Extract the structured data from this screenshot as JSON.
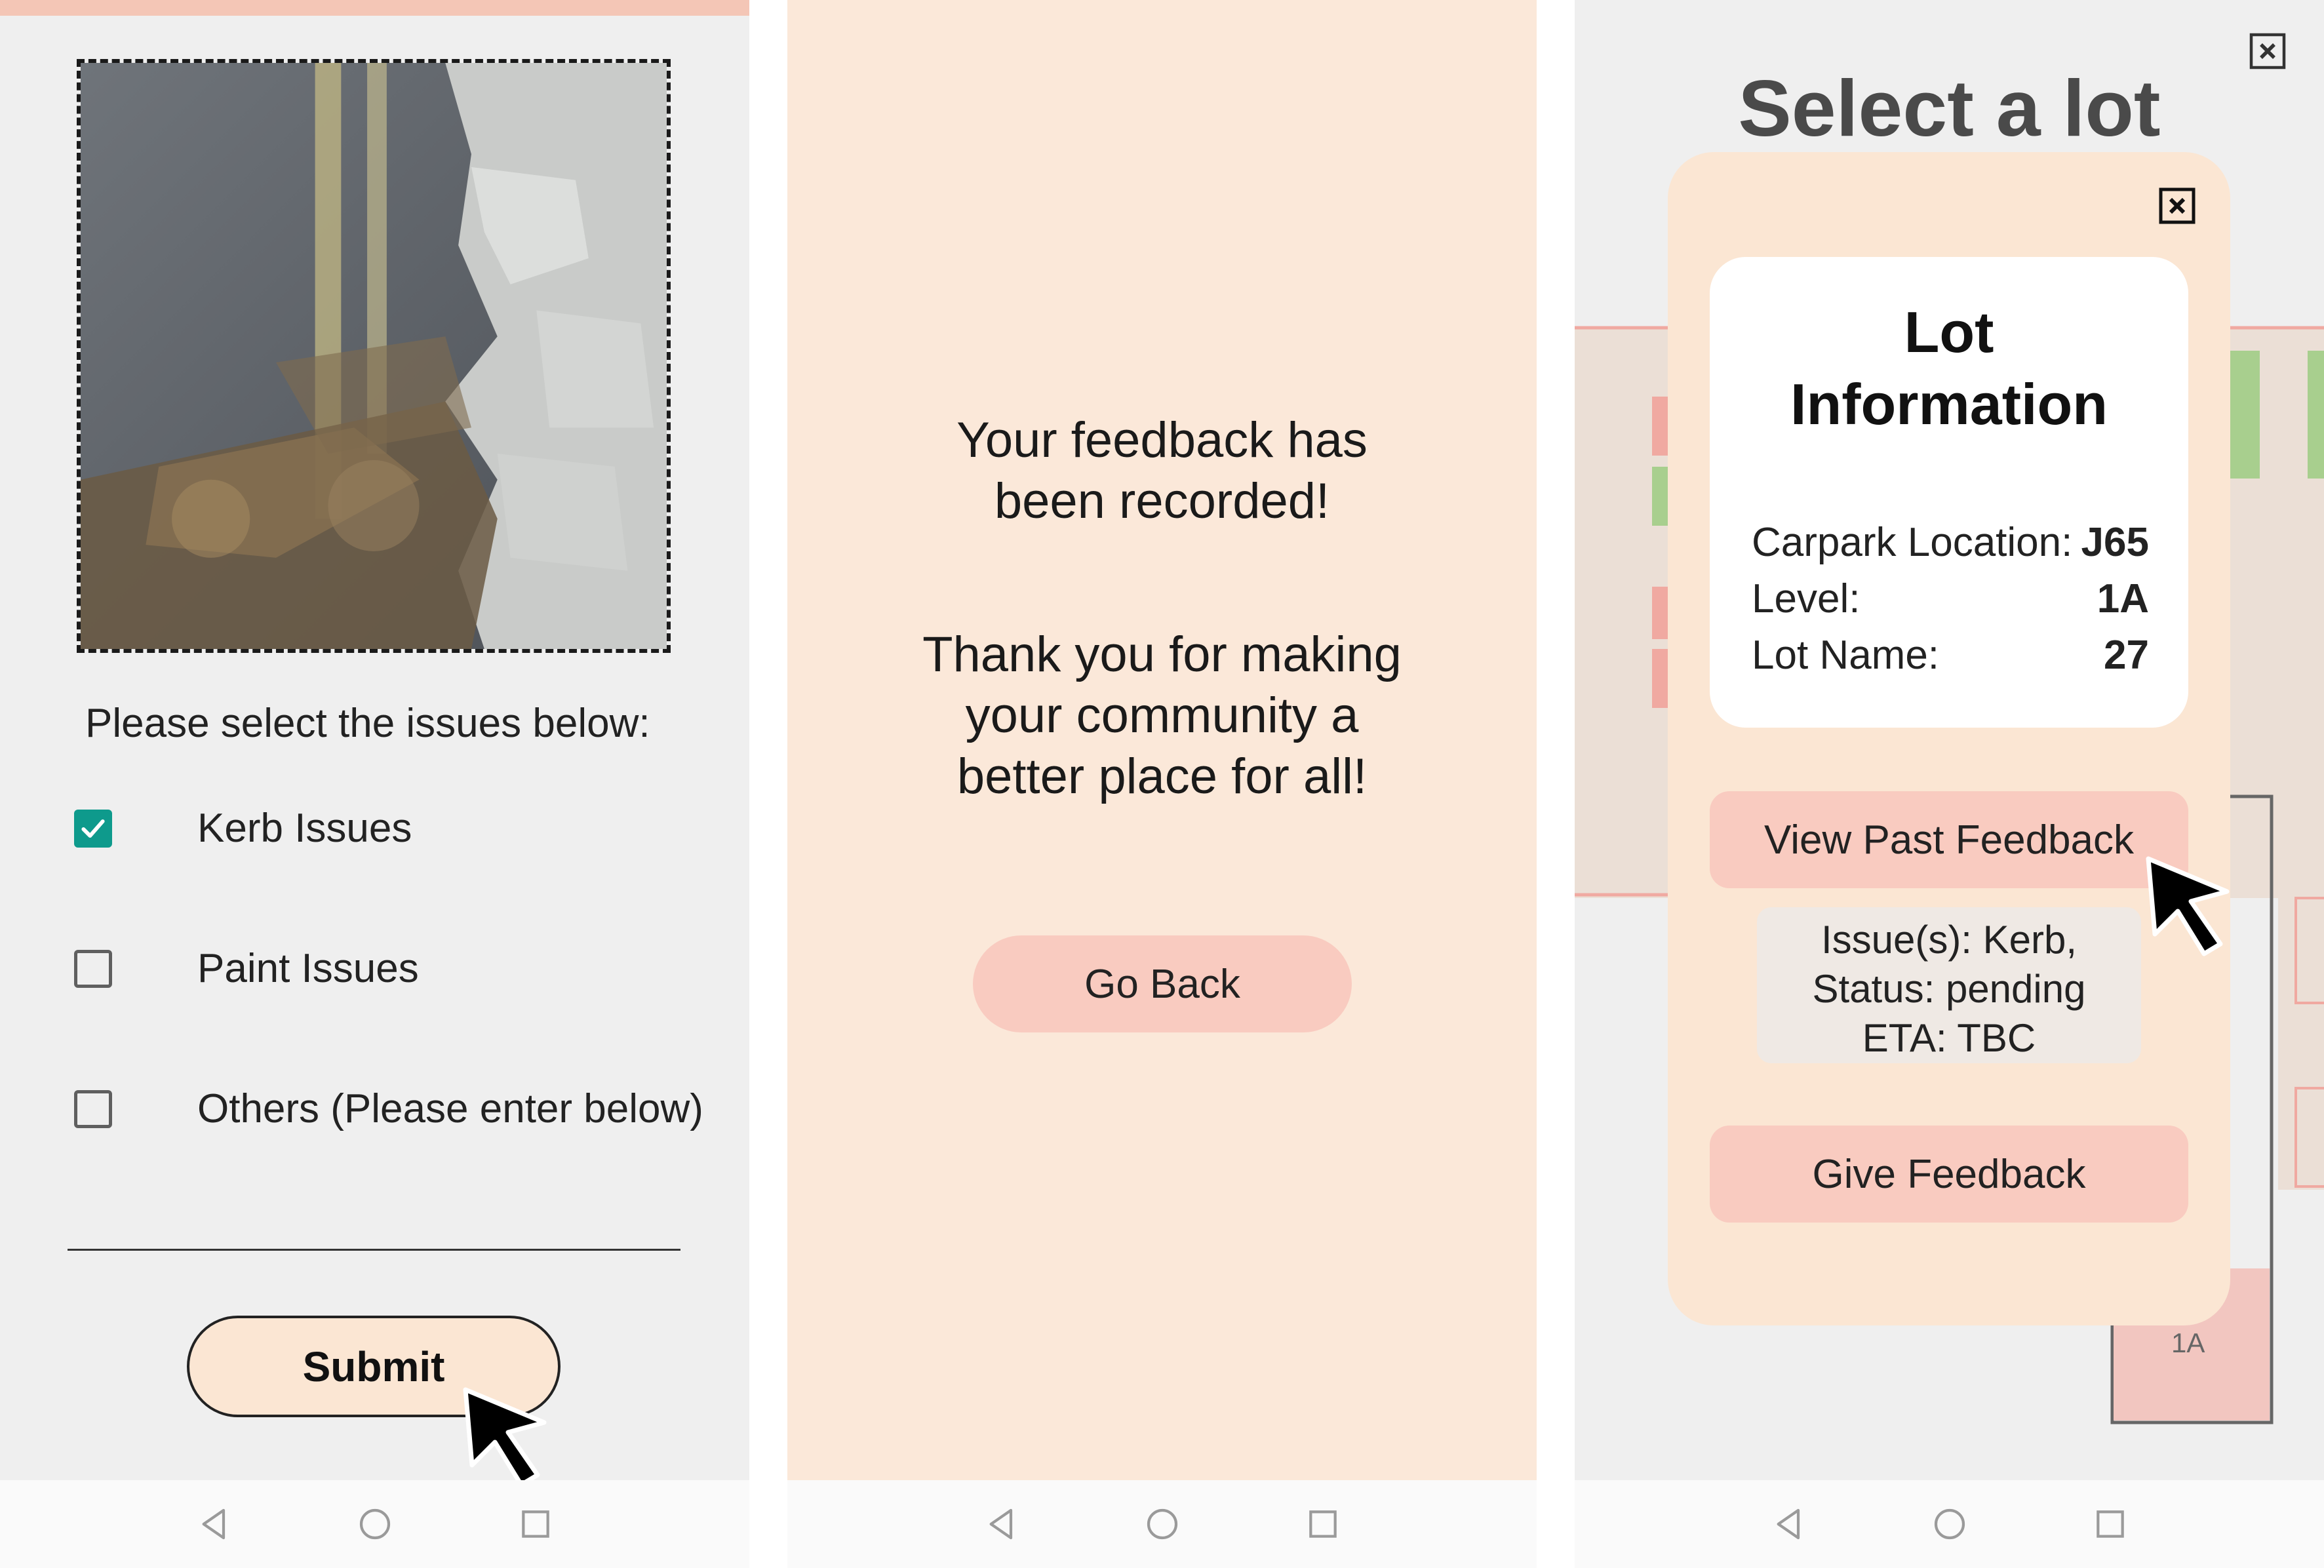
{
  "screen1": {
    "issue_prompt": "Please select the issues below:",
    "issues": [
      {
        "label": "Kerb Issues",
        "checked": true
      },
      {
        "label": "Paint Issues",
        "checked": false
      },
      {
        "label": "Others (Please enter below)",
        "checked": false
      }
    ],
    "other_input_value": "",
    "submit_label": "Submit"
  },
  "screen2": {
    "message_line1": "Your feedback has",
    "message_line2": "been recorded!",
    "thanks_line1": "Thank you for making",
    "thanks_line2": "your community a",
    "thanks_line3": "better place for all!",
    "go_back_label": "Go Back"
  },
  "screen3": {
    "title": "Select a lot",
    "modal": {
      "card_title_line1": "Lot",
      "card_title_line2": "Information",
      "rows": [
        {
          "label": "Carpark Location:",
          "value": "J65"
        },
        {
          "label": "Level:",
          "value": "1A"
        },
        {
          "label": "Lot Name:",
          "value": "27"
        }
      ],
      "view_past_label": "View Past Feedback",
      "past_feedback_lines": [
        "Issue(s): Kerb,",
        "Status: pending",
        "ETA: TBC"
      ],
      "give_feedback_label": "Give Feedback"
    },
    "map_lot_label": "1A"
  },
  "icons": {
    "back": "triangle-back-icon",
    "home": "circle-home-icon",
    "recents": "square-recents-icon",
    "close": "close-icon",
    "cursor": "pointer-cursor-icon",
    "check": "checkmark-icon"
  },
  "colors": {
    "accent_pink": "#f9cbc0",
    "peach_bg": "#fbe8d9",
    "checkbox_checked": "#0e9a8c",
    "grey_bg": "#efefef",
    "lot_green": "#a8cf8e",
    "lot_red": "#f0a9a1"
  }
}
